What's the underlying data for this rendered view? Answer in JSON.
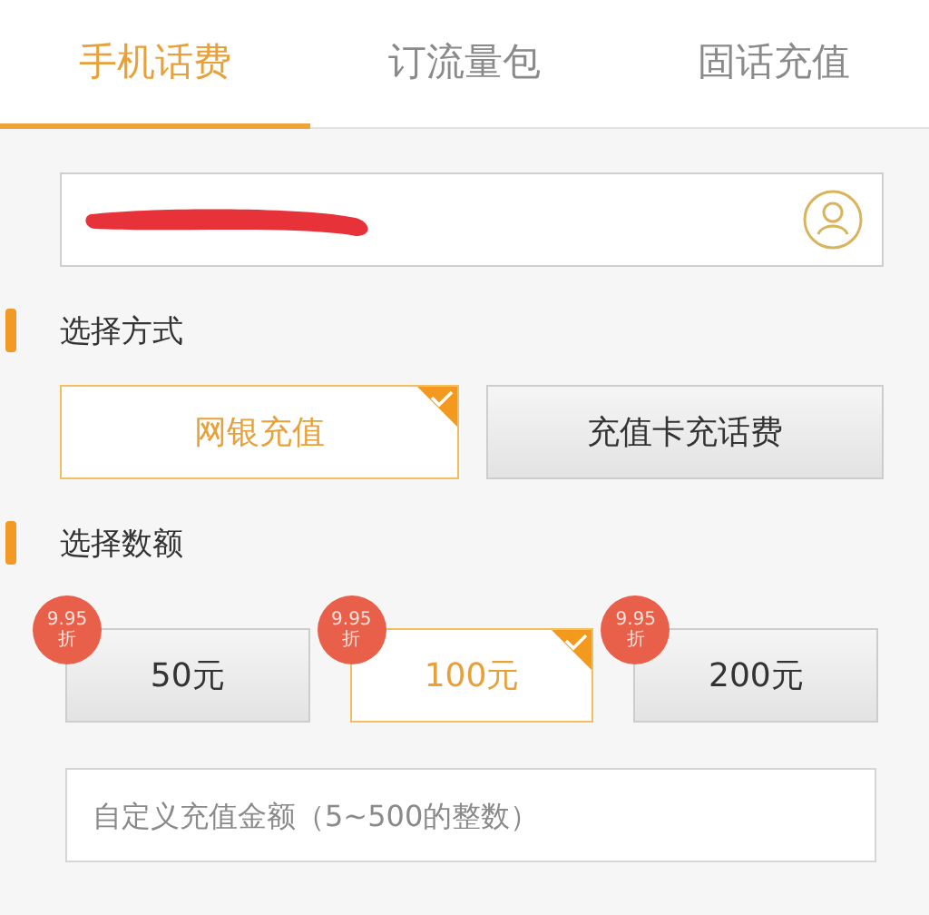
{
  "tabs": [
    {
      "label": "手机话费",
      "selected": true
    },
    {
      "label": "订流量包",
      "selected": false
    },
    {
      "label": "固话充值",
      "selected": false
    }
  ],
  "phone_field": {
    "redacted": true
  },
  "method_section": {
    "title": "选择方式",
    "options": [
      {
        "label": "网银充值",
        "selected": true
      },
      {
        "label": "充值卡充话费",
        "selected": false
      }
    ]
  },
  "amount_section": {
    "title": "选择数额",
    "options": [
      {
        "label": "50元",
        "selected": false,
        "badge": {
          "rate": "9.95",
          "unit": "折"
        }
      },
      {
        "label": "100元",
        "selected": true,
        "badge": {
          "rate": "9.95",
          "unit": "折"
        }
      },
      {
        "label": "200元",
        "selected": false,
        "badge": {
          "rate": "9.95",
          "unit": "折"
        }
      }
    ]
  },
  "custom_amount": {
    "placeholder": "自定义充值金额（5~500的整数）"
  }
}
